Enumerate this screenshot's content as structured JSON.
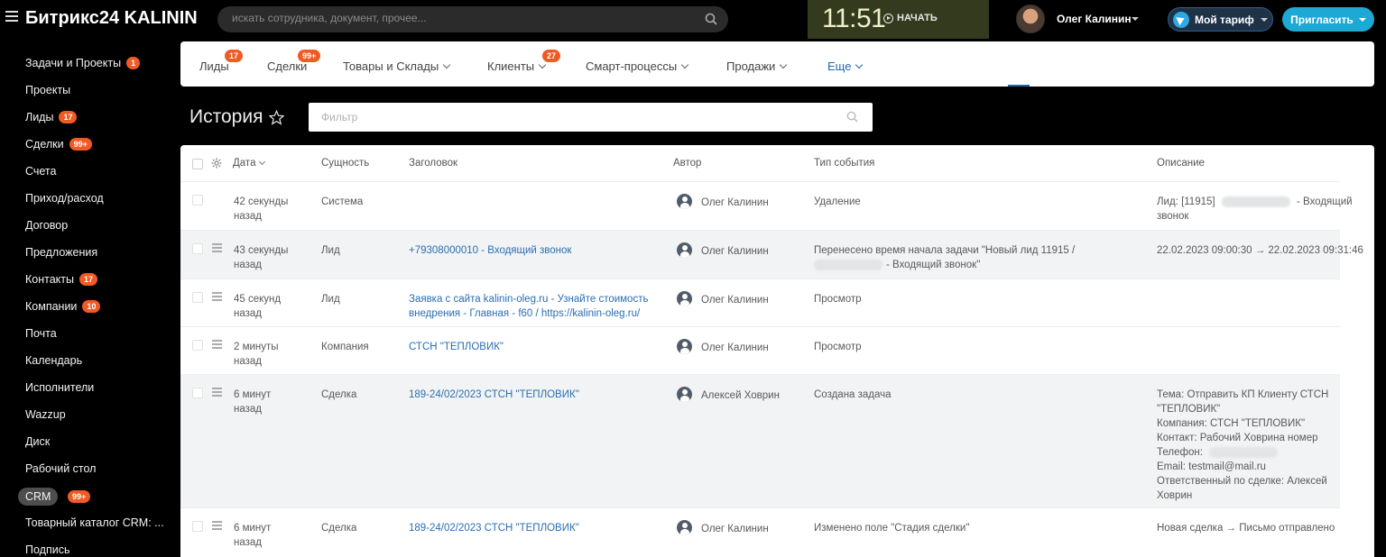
{
  "header": {
    "brand": "Битрикс24 KALININ",
    "search_placeholder": "искать сотрудника, документ, прочее...",
    "clock_time": "11:51",
    "clock_start": "НАЧАТЬ",
    "user_name": "Олег Калинин",
    "tariff_label": "Мой тариф",
    "invite_label": "Пригласить"
  },
  "sidebar": {
    "items": [
      {
        "label": "Задачи и Проекты",
        "badge": "1"
      },
      {
        "label": "Проекты",
        "badge": ""
      },
      {
        "label": "Лиды",
        "badge": "17"
      },
      {
        "label": "Сделки",
        "badge": "99+"
      },
      {
        "label": "Счета",
        "badge": ""
      },
      {
        "label": "Приход/расход",
        "badge": ""
      },
      {
        "label": "Договор",
        "badge": ""
      },
      {
        "label": "Предложения",
        "badge": ""
      },
      {
        "label": "Контакты",
        "badge": "17"
      },
      {
        "label": "Компании",
        "badge": "10"
      },
      {
        "label": "Почта",
        "badge": ""
      },
      {
        "label": "Календарь",
        "badge": ""
      },
      {
        "label": "Исполнители",
        "badge": ""
      },
      {
        "label": "Wazzup",
        "badge": ""
      },
      {
        "label": "Диск",
        "badge": ""
      },
      {
        "label": "Рабочий стол",
        "badge": ""
      },
      {
        "label": "CRM",
        "badge": "99+"
      },
      {
        "label": "Товарный каталог CRM: ...",
        "badge": ""
      },
      {
        "label": "Подпись",
        "badge": ""
      }
    ]
  },
  "nav": {
    "items": [
      {
        "label": "Лиды",
        "badge": "17"
      },
      {
        "label": "Сделки",
        "badge": "99+"
      },
      {
        "label": "Товары и Склады",
        "badge": ""
      },
      {
        "label": "Клиенты",
        "badge": "27"
      },
      {
        "label": "Смарт-процессы",
        "badge": ""
      },
      {
        "label": "Продажи",
        "badge": ""
      },
      {
        "label": "Еще",
        "badge": ""
      }
    ]
  },
  "page": {
    "title": "История",
    "filter_placeholder": "Фильтр"
  },
  "grid": {
    "columns": {
      "date": "Дата",
      "entity": "Сущность",
      "heading": "Заголовок",
      "author": "Автор",
      "event_type": "Тип события",
      "description": "Описание"
    },
    "rows": [
      {
        "date1": "42 секунды",
        "date2": "назад",
        "entity": "Система",
        "heading1": "",
        "heading2": "",
        "author": "Олег Калинин",
        "event1": "Удаление",
        "event2": "",
        "desc": [
          "Лид: [11915]",
          "- Входящий",
          "звонок"
        ]
      },
      {
        "date1": "43 секунды",
        "date2": "назад",
        "entity": "Лид",
        "heading1": "+79308000010 - Входящий звонок",
        "heading2": "",
        "author": "Олег Калинин",
        "event1": "Перенесено время начала задачи \"Новый лид 11915 /",
        "event2": "- Входящий звонок\"",
        "desc": [
          "22.02.2023 09:00:30 → 22.02.2023 09:31:46"
        ]
      },
      {
        "date1": "45 секунд",
        "date2": "назад",
        "entity": "Лид",
        "heading1": "Заявка с сайта kalinin-oleg.ru - Узнайте стоимость",
        "heading2": "внедрения - Главная - f60 / https://kalinin-oleg.ru/",
        "author": "Олег Калинин",
        "event1": "Просмотр",
        "event2": "",
        "desc": []
      },
      {
        "date1": "2 минуты",
        "date2": "назад",
        "entity": "Компания",
        "heading1": "СТСН \"ТЕПЛОВИК\"",
        "heading2": "",
        "author": "Олег Калинин",
        "event1": "Просмотр",
        "event2": "",
        "desc": []
      },
      {
        "date1": "6 минут",
        "date2": "назад",
        "entity": "Сделка",
        "heading1": "189-24/02/2023 СТСН \"ТЕПЛОВИК\"",
        "heading2": "",
        "author": "Алексей Ховрин",
        "event1": "Создана задача",
        "event2": "",
        "desc": [
          "Тема: Отправить КП Клиенту СТСН",
          "\"ТЕПЛОВИК\"",
          "Компания: СТСН \"ТЕПЛОВИК\"",
          "Контакт: Рабочий Ховрина номер",
          "Телефон:",
          "Email: testmail@mail.ru",
          "Ответственный по сделке: Алексей",
          "Ховрин"
        ]
      },
      {
        "date1": "6 минут",
        "date2": "назад",
        "entity": "Сделка",
        "heading1": "189-24/02/2023 СТСН \"ТЕПЛОВИК\"",
        "heading2": "",
        "author": "Олег Калинин",
        "event1": "Изменено поле \"Стадия сделки\"",
        "event2": "",
        "desc": [
          "Новая сделка → Письмо отправлено"
        ]
      }
    ]
  }
}
